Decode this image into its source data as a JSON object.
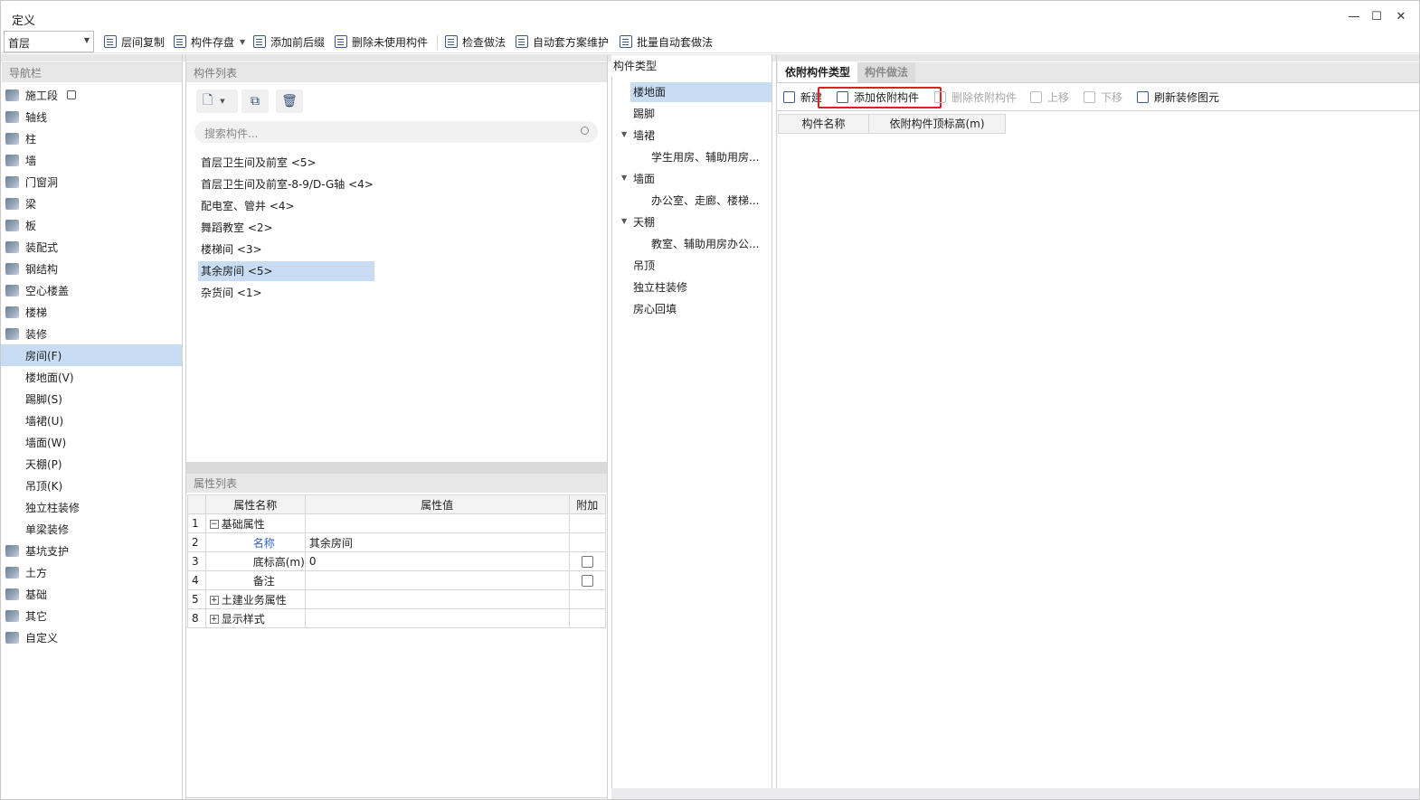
{
  "window": {
    "title": "定义",
    "controls": [
      "minimize",
      "maximize",
      "close"
    ]
  },
  "toolbar": {
    "floor_value": "首层",
    "buttons": [
      {
        "label": "层间复制",
        "icon": "copy-icon"
      },
      {
        "label": "构件存盘",
        "icon": "save-icon"
      },
      {
        "label": "添加前后缀",
        "icon": "prefix-icon"
      },
      {
        "label": "删除未使用构件",
        "icon": "delete-list-icon"
      },
      {
        "label": "检查做法",
        "icon": "check-icon"
      },
      {
        "label": "自动套方案维护",
        "icon": "scheme-icon"
      },
      {
        "label": "批量自动套做法",
        "icon": "batch-icon"
      }
    ]
  },
  "nav": {
    "header": "导航栏",
    "items": [
      {
        "label": "施工段",
        "icon": "segment-icon"
      },
      {
        "label": "轴线",
        "icon": "grid-icon"
      },
      {
        "label": "柱",
        "icon": "column-icon"
      },
      {
        "label": "墙",
        "icon": "wall-icon"
      },
      {
        "label": "门窗洞",
        "icon": "door-window-icon"
      },
      {
        "label": "梁",
        "icon": "beam-icon"
      },
      {
        "label": "板",
        "icon": "slab-icon"
      },
      {
        "label": "装配式",
        "icon": "prefab-icon"
      },
      {
        "label": "钢结构",
        "icon": "steel-icon"
      },
      {
        "label": "空心楼盖",
        "icon": "hollow-floor-icon"
      },
      {
        "label": "楼梯",
        "icon": "stairs-icon"
      },
      {
        "label": "装修",
        "icon": "decoration-icon"
      },
      {
        "label": "房间(F)",
        "sub": true,
        "selected": true
      },
      {
        "label": "楼地面(V)",
        "sub": true
      },
      {
        "label": "踢脚(S)",
        "sub": true
      },
      {
        "label": "墙裙(U)",
        "sub": true
      },
      {
        "label": "墙面(W)",
        "sub": true
      },
      {
        "label": "天棚(P)",
        "sub": true
      },
      {
        "label": "吊顶(K)",
        "sub": true
      },
      {
        "label": "独立柱装修",
        "sub": true
      },
      {
        "label": "单梁装修",
        "sub": true
      },
      {
        "label": "基坑支护",
        "icon": "pit-icon"
      },
      {
        "label": "土方",
        "icon": "earthwork-icon"
      },
      {
        "label": "基础",
        "icon": "foundation-icon"
      },
      {
        "label": "其它",
        "icon": "other-icon"
      },
      {
        "label": "自定义",
        "icon": "custom-icon"
      }
    ]
  },
  "components": {
    "header": "构件列表",
    "search_placeholder": "搜索构件...",
    "items": [
      {
        "label": "首层卫生间及前室 <5>"
      },
      {
        "label": "首层卫生间及前室-8-9/D-G轴 <4>"
      },
      {
        "label": "配电室、管井 <4>"
      },
      {
        "label": "舞蹈教室 <2>"
      },
      {
        "label": "楼梯间 <3>"
      },
      {
        "label": "其余房间 <5>",
        "selected": true
      },
      {
        "label": "杂货间 <1>"
      }
    ]
  },
  "properties": {
    "header": "属性列表",
    "columns": [
      "属性名称",
      "属性值",
      "附加"
    ],
    "rows": [
      {
        "num": "1",
        "name": "基础属性",
        "value": "",
        "expand": "−"
      },
      {
        "num": "2",
        "name": "名称",
        "value": "其余房间"
      },
      {
        "num": "3",
        "name": "底标高(m)",
        "value": "0",
        "checkbox": true
      },
      {
        "num": "4",
        "name": "备注",
        "value": "",
        "checkbox": true
      },
      {
        "num": "5",
        "name": "土建业务属性",
        "value": "",
        "expand": "+"
      },
      {
        "num": "8",
        "name": "显示样式",
        "value": "",
        "expand": "+"
      }
    ]
  },
  "types": {
    "header": "构件类型",
    "items": [
      {
        "label": "楼地面",
        "selected": true
      },
      {
        "label": "踢脚"
      },
      {
        "label": "墙裙",
        "caret": true
      },
      {
        "label": "学生用房、辅助用房...",
        "child": true
      },
      {
        "label": "墙面",
        "caret": true
      },
      {
        "label": "办公室、走廊、楼梯...",
        "child": true
      },
      {
        "label": "天棚",
        "caret": true
      },
      {
        "label": "教室、辅助用房办公...",
        "child": true
      },
      {
        "label": "吊顶"
      },
      {
        "label": "独立柱装修"
      },
      {
        "label": "房心回填"
      }
    ]
  },
  "right": {
    "tabs": [
      "依附构件类型",
      "构件做法"
    ],
    "buttons": [
      {
        "label": "新建",
        "icon": "new-icon"
      },
      {
        "label": "添加依附构件",
        "icon": "add-attached-icon"
      },
      {
        "label": "删除依附构件",
        "icon": "delete-attached-icon"
      },
      {
        "label": "上移",
        "icon": "move-up-icon"
      },
      {
        "label": "下移",
        "icon": "move-down-icon"
      },
      {
        "label": "刷新装修图元",
        "icon": "refresh-icon"
      }
    ],
    "columns": [
      "构件名称",
      "依附构件顶标高(m)"
    ]
  }
}
